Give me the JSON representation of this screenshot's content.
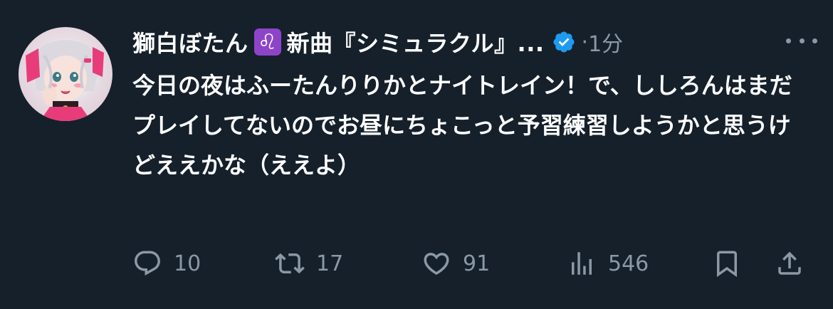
{
  "tweet": {
    "display_name": "獅白ぼたん",
    "zodiac_icon": "leo",
    "name_suffix": "新曲『シミュラクル』...",
    "verified": true,
    "separator": "·",
    "time": "1分",
    "text": "今日の夜はふーたんりりかとナイトレイン！で、ししろんはまだプレイしてないのでお昼にちょこっと予習練習しようかと思うけどええかな（ええよ）"
  },
  "actions": {
    "reply_count": "10",
    "retweet_count": "17",
    "like_count": "91",
    "views_count": "546"
  },
  "colors": {
    "background": "#15202b",
    "text_primary": "#ffffff",
    "text_secondary": "#8b98a5",
    "verified_blue": "#1d9bf0",
    "leo_badge": "#8e44c9"
  }
}
